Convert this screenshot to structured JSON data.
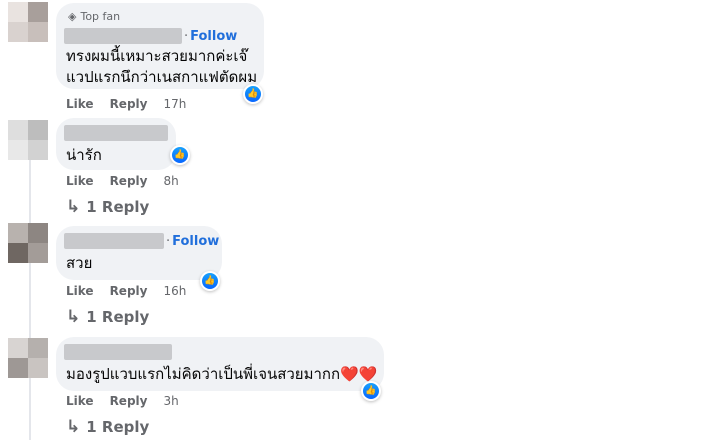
{
  "comments": [
    {
      "badge": "Top fan",
      "badge_icon": "diamond-icon",
      "follow": "Follow",
      "text_line1": "ทรงผมนี้เหมาะสวยมากค่ะเจ๊",
      "text_line2": "แวปแรกนึกว่าเนสกาแฟตัดผม",
      "like": "Like",
      "reply": "Reply",
      "time": "17h",
      "reaction_icon": "thumbs-up-icon",
      "avatar_colors": [
        "#e9e3e0",
        "#a89f9b",
        "#d9d2cf",
        "#c8bfbb"
      ]
    },
    {
      "text": "น่ารัก",
      "like": "Like",
      "reply": "Reply",
      "time": "8h",
      "replies": "1 Reply",
      "reaction_icon": "thumbs-up-icon",
      "avatar_colors": [
        "#dedede",
        "#bdbdbd",
        "#e8e8e8",
        "#d2d2d2"
      ]
    },
    {
      "follow": "Follow",
      "text": "สวย",
      "like": "Like",
      "reply": "Reply",
      "time": "16h",
      "replies": "1 Reply",
      "reaction_icon": "thumbs-up-icon",
      "avatar_colors": [
        "#b8b2ae",
        "#8d8682",
        "#6f6762",
        "#a39c98"
      ]
    },
    {
      "text": "มองรูปแวบแรกไม่คิดว่าเป็นพี่เจนสวยมากก",
      "emoji": "❤️❤️",
      "like": "Like",
      "reply": "Reply",
      "time": "3h",
      "replies": "1 Reply",
      "reaction_icon": "thumbs-up-icon",
      "avatar_colors": [
        "#d8d4d2",
        "#b5b0ad",
        "#9e9895",
        "#c9c4c1"
      ]
    }
  ],
  "colors": {
    "bubble": "#f0f2f5",
    "follow": "#216fdb",
    "meta": "#65676b",
    "like_blue": "#0866ff"
  }
}
